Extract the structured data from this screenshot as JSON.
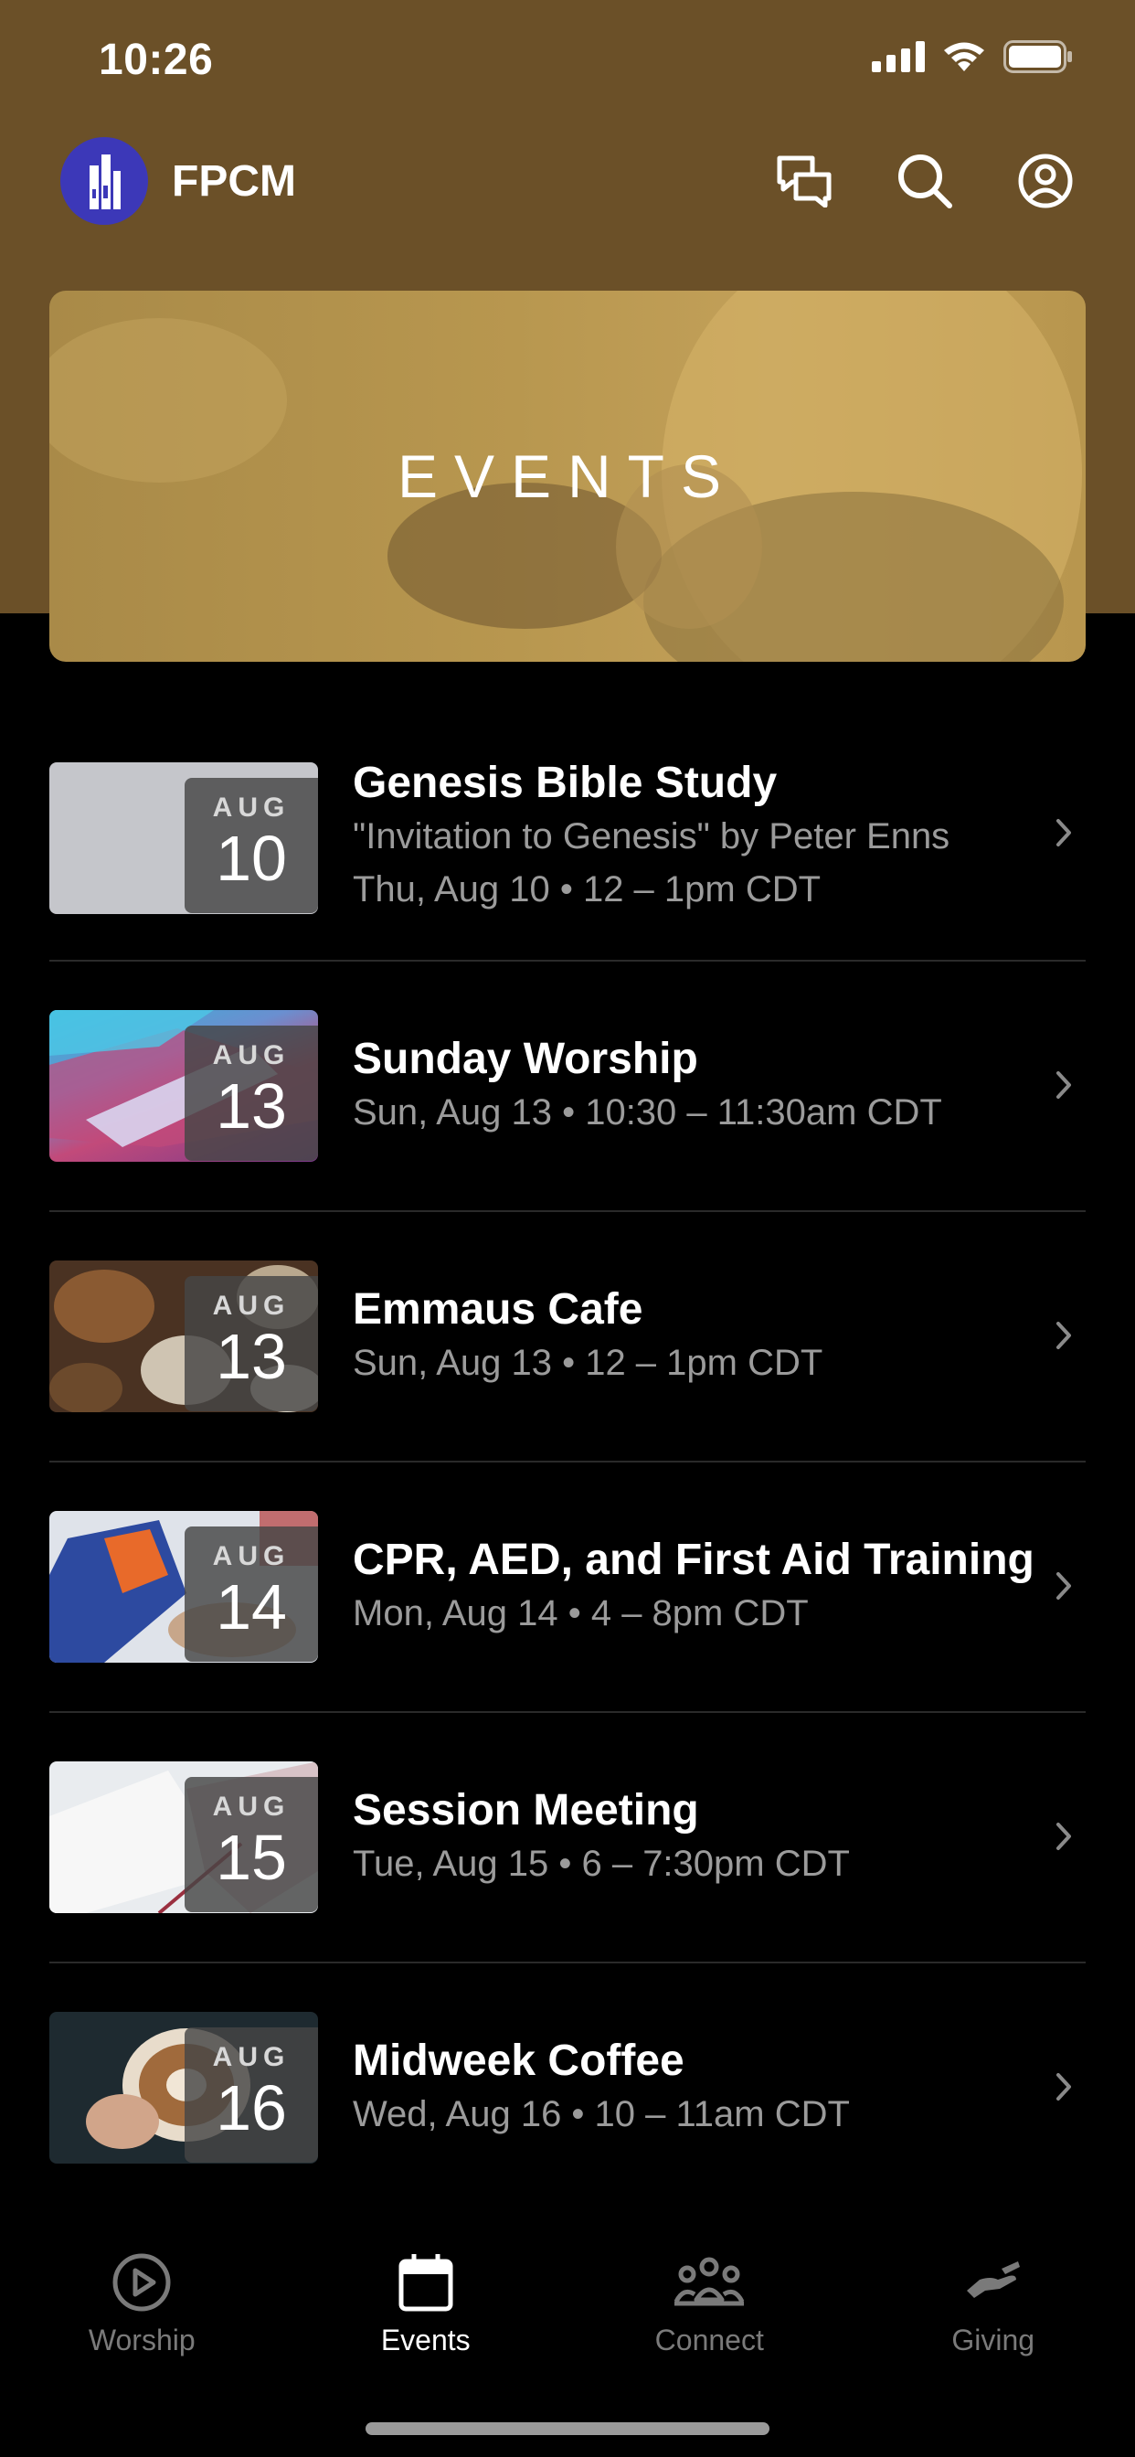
{
  "status_bar": {
    "time": "10:26"
  },
  "header": {
    "app_name": "FPCM"
  },
  "banner": {
    "title": "EVENTS"
  },
  "events": [
    {
      "month": "AUG",
      "day": "10",
      "title": "Genesis Bible Study",
      "description": "\"Invitation to Genesis\" by Peter Enns",
      "when": "Thu, Aug 10 • 12 – 1pm CDT"
    },
    {
      "month": "AUG",
      "day": "13",
      "title": "Sunday Worship",
      "when": "Sun, Aug 13 • 10:30 – 11:30am CDT"
    },
    {
      "month": "AUG",
      "day": "13",
      "title": "Emmaus Cafe",
      "when": "Sun, Aug 13 • 12 – 1pm CDT"
    },
    {
      "month": "AUG",
      "day": "14",
      "title": "CPR, AED, and First Aid Training",
      "when": "Mon, Aug 14 • 4 – 8pm CDT"
    },
    {
      "month": "AUG",
      "day": "15",
      "title": "Session Meeting",
      "when": "Tue, Aug 15 • 6 – 7:30pm CDT"
    },
    {
      "month": "AUG",
      "day": "16",
      "title": "Midweek Coffee",
      "when": "Wed, Aug 16 • 10 – 11am CDT"
    }
  ],
  "tabs": [
    {
      "label": "Worship",
      "icon": "play-circle-icon"
    },
    {
      "label": "Events",
      "icon": "calendar-icon",
      "active": true
    },
    {
      "label": "Connect",
      "icon": "people-icon"
    },
    {
      "label": "Giving",
      "icon": "giving-hand-icon"
    }
  ],
  "colors": {
    "header_bg": "#6b5028",
    "logo_bg": "#3c38b8",
    "banner": "#b8974f"
  }
}
